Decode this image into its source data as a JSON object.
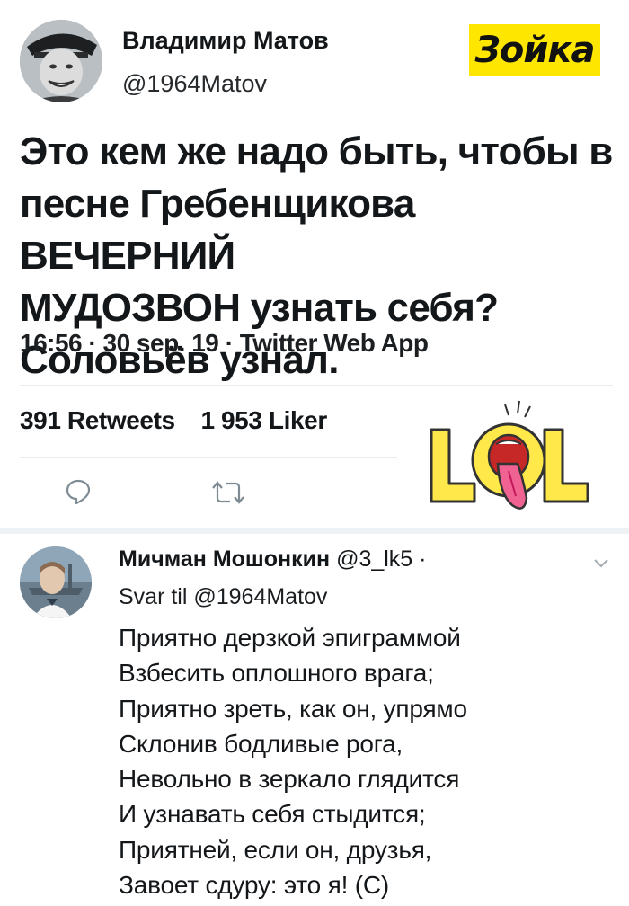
{
  "tweet": {
    "author_name": "Владимир Матов",
    "author_handle": "@1964Matov",
    "badge_text": "Зойка",
    "text_lines": [
      "Это кем же надо быть, чтобы в",
      "песне Гребенщикова ВЕЧЕРНИЙ",
      "МУДОЗВОН узнать себя?",
      "Соловьёв узнал."
    ],
    "meta": "16:56 · 30 sep. 19 · Twitter Web App",
    "retweet_count": "391",
    "retweet_label": "Retweets",
    "like_count": "1 953",
    "like_label": "Liker",
    "sticker_text": "LOL",
    "icons": [
      "reply-icon",
      "retweet-icon"
    ]
  },
  "reply": {
    "author_name": "Мичман Мошонкин",
    "author_handle": "@3_lk5",
    "separator": "·",
    "reply_to": "Svar til @1964Matov",
    "text_lines": [
      "Приятно дерзкой эпиграммой",
      "Взбесить оплошного врага;",
      "Приятно зреть, как он, упрямо",
      "Склонив бодливые рога,",
      "Невольно в зеркало глядится",
      "И узнавать себя стыдится;",
      "Приятней, если он, друзья,",
      "Завоет сдуру: это я! (С)"
    ],
    "icons": [
      "chevron-down-icon"
    ]
  },
  "colors": {
    "badge": "#ffe600",
    "icon_gray": "#7f8b93",
    "divider": "#e6ecf0",
    "sticker_yellow": "#ffe94a",
    "sticker_red": "#e53935"
  }
}
